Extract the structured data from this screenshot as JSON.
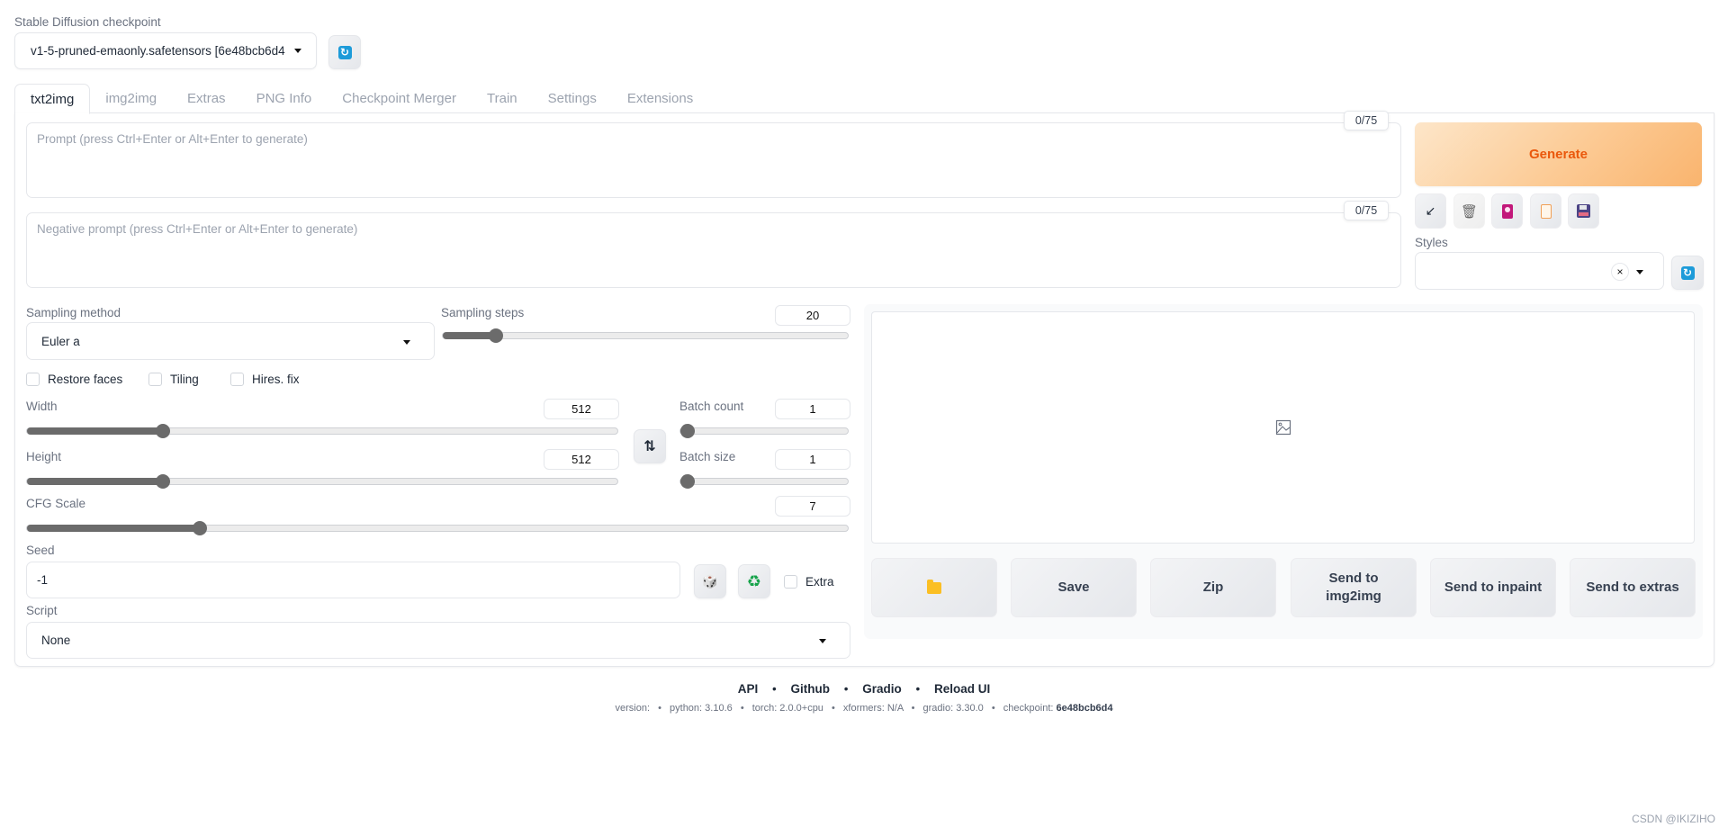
{
  "checkpoint": {
    "label": "Stable Diffusion checkpoint",
    "value": "v1-5-pruned-emaonly.safetensors [6e48bcb6d4",
    "refresh_icon": "refresh-icon"
  },
  "tabs": [
    {
      "label": "txt2img",
      "active": true
    },
    {
      "label": "img2img",
      "active": false
    },
    {
      "label": "Extras",
      "active": false
    },
    {
      "label": "PNG Info",
      "active": false
    },
    {
      "label": "Checkpoint Merger",
      "active": false
    },
    {
      "label": "Train",
      "active": false
    },
    {
      "label": "Settings",
      "active": false
    },
    {
      "label": "Extensions",
      "active": false
    }
  ],
  "prompt": {
    "placeholder": "Prompt (press Ctrl+Enter or Alt+Enter to generate)",
    "value": "",
    "token_count": "0/75"
  },
  "negative_prompt": {
    "placeholder": "Negative prompt (press Ctrl+Enter or Alt+Enter to generate)",
    "value": "",
    "token_count": "0/75"
  },
  "generate": {
    "label": "Generate",
    "color": "#ea580c"
  },
  "tools": [
    {
      "name": "read-params-icon",
      "glyph": "↙"
    },
    {
      "name": "trash-icon",
      "glyph": "🗑"
    },
    {
      "name": "extra-networks-icon",
      "glyph": "🎴"
    },
    {
      "name": "clipboard-icon",
      "glyph": "📋"
    },
    {
      "name": "save-style-icon",
      "glyph": "💾"
    }
  ],
  "styles": {
    "label": "Styles",
    "value": "",
    "clear_glyph": "×"
  },
  "sampling_method": {
    "label": "Sampling method",
    "value": "Euler a"
  },
  "sampling_steps": {
    "label": "Sampling steps",
    "value": "20",
    "fraction": 0.13
  },
  "checkboxes": {
    "restore_faces": {
      "label": "Restore faces",
      "checked": false
    },
    "tiling": {
      "label": "Tiling",
      "checked": false
    },
    "hires_fix": {
      "label": "Hires. fix",
      "checked": false
    }
  },
  "width": {
    "label": "Width",
    "value": "512",
    "fraction": 0.23
  },
  "height": {
    "label": "Height",
    "value": "512",
    "fraction": 0.23
  },
  "swap_glyph": "⇅",
  "batch_count": {
    "label": "Batch count",
    "value": "1",
    "fraction": 0.0
  },
  "batch_size": {
    "label": "Batch size",
    "value": "1",
    "fraction": 0.0
  },
  "cfg_scale": {
    "label": "CFG Scale",
    "value": "7",
    "fraction": 0.21
  },
  "seed": {
    "label": "Seed",
    "value": "-1",
    "dice_glyph": "🎲",
    "recycle_glyph": "♻",
    "extra_label": "Extra"
  },
  "script": {
    "label": "Script",
    "value": "None"
  },
  "output": {
    "placeholder_icon": "image-icon",
    "buttons": {
      "folder_glyph": "📁",
      "save": "Save",
      "zip": "Zip",
      "send_img2img": "Send to img2img",
      "send_inpaint": "Send to inpaint",
      "send_extras": "Send to extras"
    }
  },
  "footer": {
    "links": [
      "API",
      "Github",
      "Gradio",
      "Reload UI"
    ],
    "version": {
      "version": "version:",
      "python": "python: 3.10.6",
      "torch": "torch: 2.0.0+cpu",
      "xformers": "xformers: N/A",
      "gradio": "gradio: 3.30.0",
      "checkpoint_label": "checkpoint:",
      "checkpoint_hash": "6e48bcb6d4"
    }
  },
  "watermark": "CSDN @IKIZIHO"
}
